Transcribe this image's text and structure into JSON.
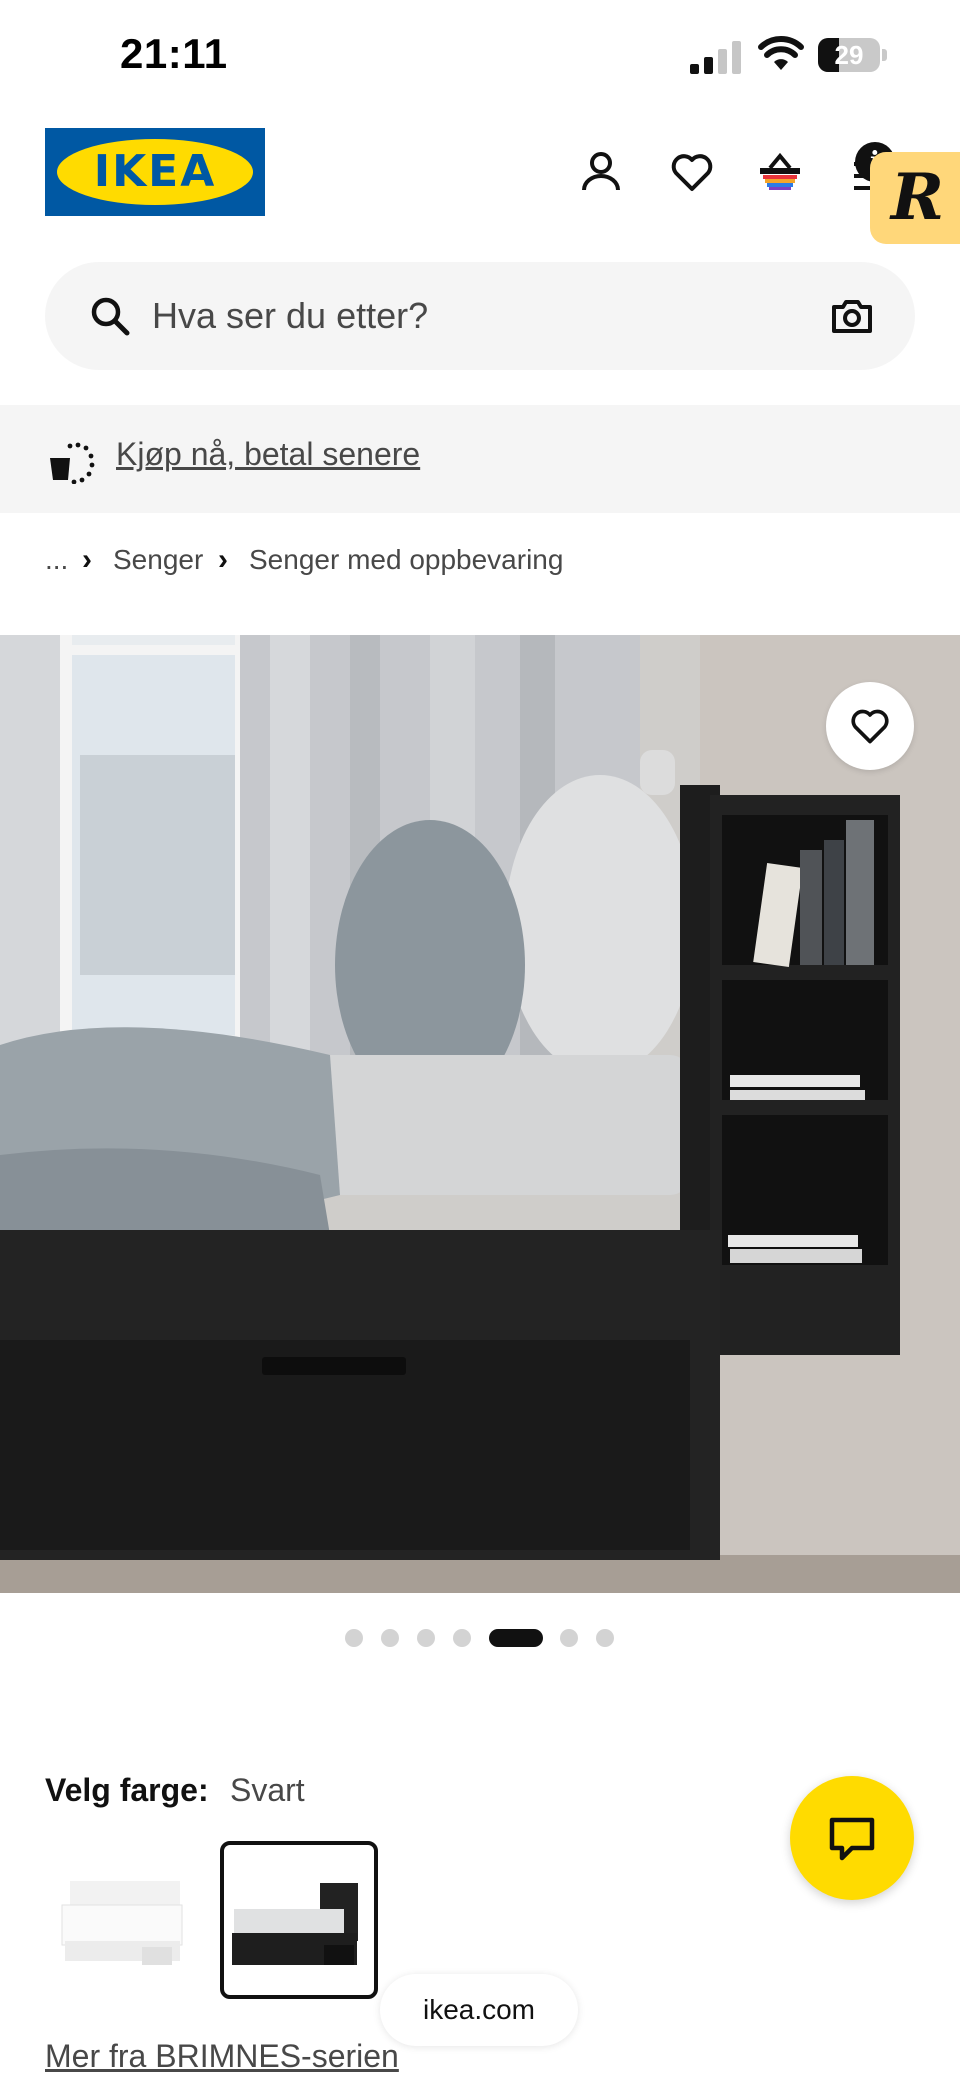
{
  "status_bar": {
    "time": "21:11",
    "battery": "29"
  },
  "header": {
    "logo_text": "IKEA",
    "info_badge": "i",
    "extension_badge": "R"
  },
  "search": {
    "placeholder": "Hva ser du etter?"
  },
  "banner": {
    "link": "Kjøp nå, betal senere"
  },
  "breadcrumb": {
    "items": [
      "...",
      "Senger",
      "Senger med oppbevaring"
    ]
  },
  "gallery": {
    "image_count": 7,
    "active_index": 5
  },
  "color_picker": {
    "label": "Velg farge:",
    "value": "Svart",
    "options": [
      {
        "name": "white",
        "selected": false
      },
      {
        "name": "black",
        "selected": true
      }
    ]
  },
  "footer": {
    "url": "ikea.com",
    "series_link": "Mer fra BRIMNES-serien"
  },
  "colors": {
    "brand_blue": "#0058a3",
    "brand_yellow": "#ffdb00",
    "extension_yellow": "#ffd77a"
  }
}
